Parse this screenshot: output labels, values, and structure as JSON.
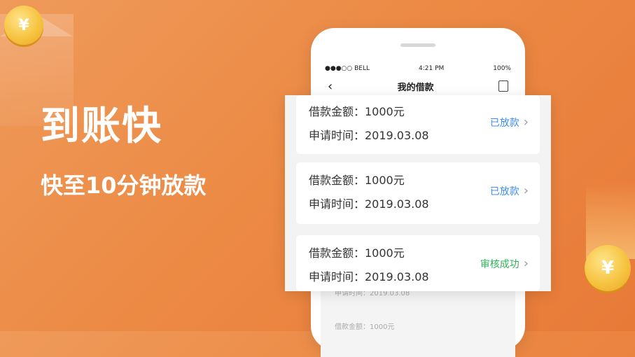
{
  "promo": {
    "headline": "到账快",
    "subline": "快至10分钟放款"
  },
  "decor": {
    "coin_symbol": "¥",
    "coin_icon": "yen-coin-icon"
  },
  "phone": {
    "status_bar": {
      "carrier": "●●●○○ BELL",
      "time": "4:21 PM",
      "battery": "100%"
    },
    "nav": {
      "back_icon": "chevron-left-icon",
      "title": "我的借款",
      "doc_icon": "document-icon"
    },
    "ghost_rows": [
      "申请时间：2019.03.08",
      "借款金额：1000元"
    ]
  },
  "loans": [
    {
      "amount_label": "借款金额：1000元",
      "date_label": "申请时间：2019.03.08",
      "status": "已放款",
      "status_color": "#3d8ef0"
    },
    {
      "amount_label": "借款金额：1000元",
      "date_label": "申请时间：2019.03.08",
      "status": "已放款",
      "status_color": "#3d8ef0"
    },
    {
      "amount_label": "借款金额：1000元",
      "date_label": "申请时间：2019.03.08",
      "status": "审核成功",
      "status_color": "#2fb45a"
    }
  ],
  "colors": {
    "background": "#ec8a45",
    "coin": "#f6c441"
  }
}
